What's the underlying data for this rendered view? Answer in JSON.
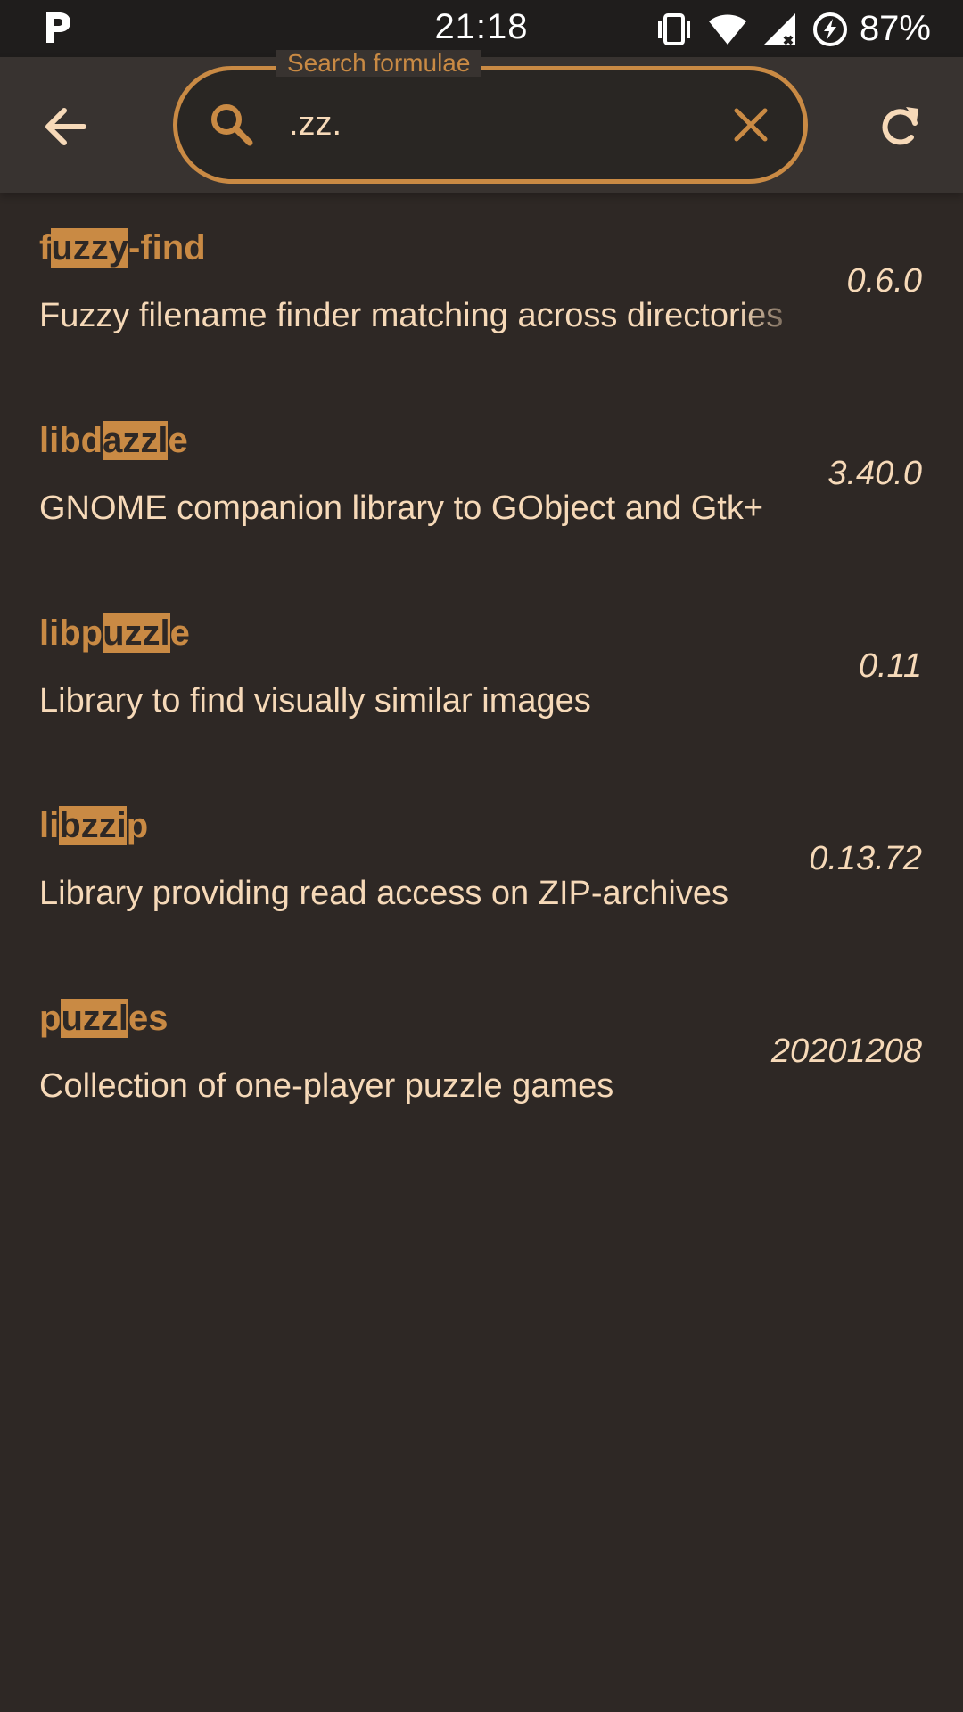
{
  "status_bar": {
    "time": "21:18",
    "battery": "87%",
    "icons": [
      "parking-icon",
      "vibrate-icon",
      "wifi-icon",
      "signal-icon",
      "battery-saver-icon"
    ]
  },
  "app_bar": {
    "search_label": "Search formulae",
    "search_value": ".zz.",
    "icons": [
      "back-arrow-icon",
      "search-icon",
      "clear-icon",
      "refresh-icon"
    ]
  },
  "colors": {
    "background": "#2e2825",
    "app_bar": "#383330",
    "accent": "#c98a44",
    "text": "#f6d9b8"
  },
  "results": [
    {
      "name": "fuzzy-find",
      "name_parts": [
        {
          "t": "f",
          "h": false
        },
        {
          "t": "uzzy",
          "h": true
        },
        {
          "t": "-find",
          "h": false
        }
      ],
      "description": "Fuzzy filename finder matching across directories",
      "version": "0.6.0"
    },
    {
      "name": "libdazzle",
      "name_parts": [
        {
          "t": "libd",
          "h": false
        },
        {
          "t": "azzl",
          "h": true
        },
        {
          "t": "e",
          "h": false
        }
      ],
      "description": "GNOME companion library to GObject and Gtk+",
      "version": "3.40.0"
    },
    {
      "name": "libpuzzle",
      "name_parts": [
        {
          "t": "libp",
          "h": false
        },
        {
          "t": "uzzl",
          "h": true
        },
        {
          "t": "e",
          "h": false
        }
      ],
      "description": "Library to find visually similar images",
      "version": "0.11"
    },
    {
      "name": "libzzip",
      "name_parts": [
        {
          "t": "li",
          "h": false
        },
        {
          "t": "bzzi",
          "h": true
        },
        {
          "t": "p",
          "h": false
        }
      ],
      "description": "Library providing read access on ZIP-archives",
      "version": "0.13.72"
    },
    {
      "name": "puzzles",
      "name_parts": [
        {
          "t": "p",
          "h": false
        },
        {
          "t": "uzzl",
          "h": true
        },
        {
          "t": "es",
          "h": false
        }
      ],
      "description": "Collection of one-player puzzle games",
      "version": "20201208"
    }
  ]
}
